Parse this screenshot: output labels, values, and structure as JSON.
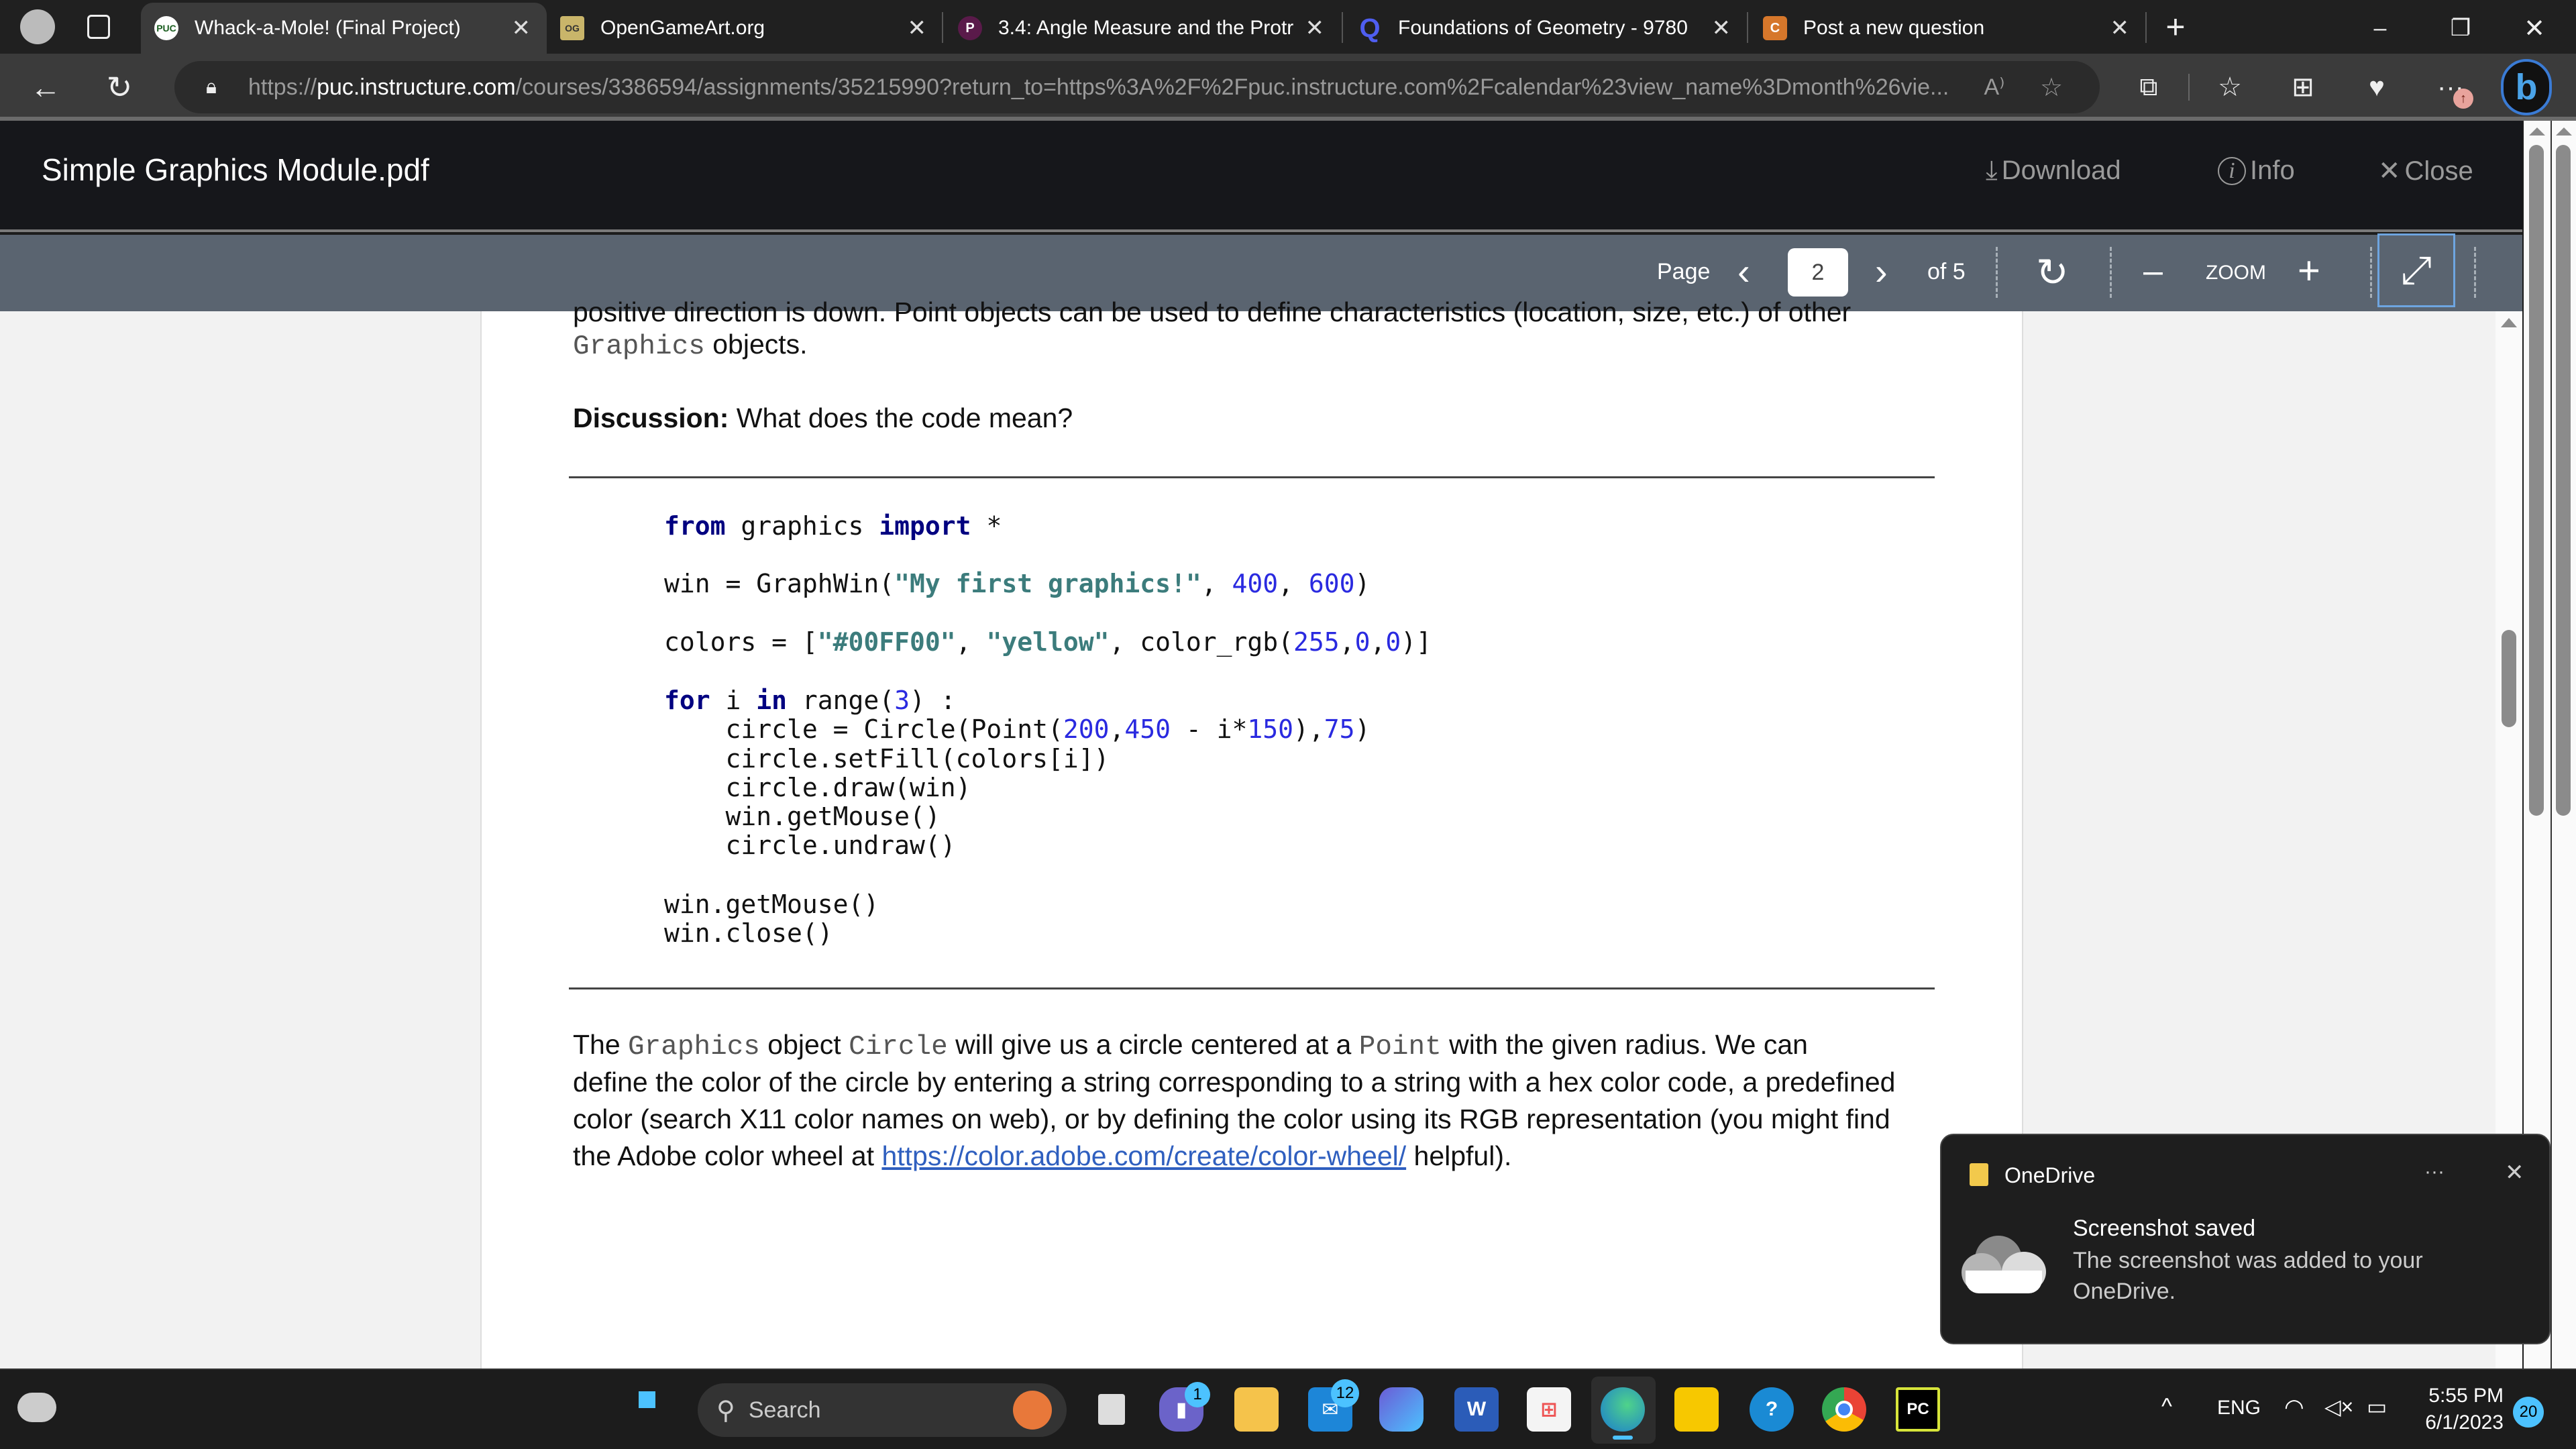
{
  "browser": {
    "tabs": [
      {
        "title": "Whack-a-Mole! (Final Project)",
        "favicon": "PUC",
        "active": true
      },
      {
        "title": "OpenGameArt.org",
        "favicon": "OG",
        "active": false
      },
      {
        "title": "3.4: Angle Measure and the Protr",
        "favicon": "P",
        "active": false
      },
      {
        "title": "Foundations of Geometry - 9780",
        "favicon": "Q",
        "active": false
      },
      {
        "title": "Post a new question",
        "favicon": "C",
        "active": false
      }
    ],
    "new_tab": "+",
    "url_prefix": "https://",
    "url_host": "puc.instructure.com",
    "url_rest": "/courses/3386594/assignments/35215990?return_to=https%3A%2F%2Fpuc.instructure.com%2Fcalendar%23view_name%3Dmonth%26vie...",
    "window_controls": {
      "minimize": "–",
      "restore": "❐",
      "close": "✕"
    }
  },
  "viewer": {
    "file_title": "Simple Graphics Module.pdf",
    "download_label": "Download",
    "info_label": "Info",
    "close_label": "Close",
    "page_label": "Page",
    "current_page": "2",
    "of_label": "of 5",
    "zoom_label": "ZOOM"
  },
  "document": {
    "cut_line": "positive direction is down.  Point  objects can be used to define characteristics (location, size, etc.) of other",
    "graphics_word": "Graphics",
    "objects_word": " objects.",
    "discussion_bold": "Discussion:",
    "discussion_text": " What does the code mean?",
    "code": {
      "l1_kw1": "from",
      "l1_mid": " graphics ",
      "l1_kw2": "import",
      "l1_end": " *",
      "l2_a": "win = GraphWin(",
      "l2_str": "\"My first graphics!\"",
      "l2_b": ", ",
      "l2_n1": "400",
      "l2_c": ", ",
      "l2_n2": "600",
      "l2_d": ")",
      "l3_a": "colors = [",
      "l3_s1": "\"#00FF00\"",
      "l3_b": ", ",
      "l3_s2": "\"yellow\"",
      "l3_c": ", color_rgb(",
      "l3_n1": "255",
      "l3_d": ",",
      "l3_n2": "0",
      "l3_e": ",",
      "l3_n3": "0",
      "l3_f": ")]",
      "l4_kw1": "for",
      "l4_a": " i ",
      "l4_kw2": "in",
      "l4_b": " range(",
      "l4_n": "3",
      "l4_c": ") :",
      "l5_a": "    circle = Circle(Point(",
      "l5_n1": "200",
      "l5_b": ",",
      "l5_n2": "450",
      "l5_c": " - i*",
      "l5_n3": "150",
      "l5_d": "),",
      "l5_n4": "75",
      "l5_e": ")",
      "l6": "    circle.setFill(colors[i])",
      "l7": "    circle.draw(win)",
      "l8": "    win.getMouse()",
      "l9": "    circle.undraw()",
      "l10": "win.getMouse()",
      "l11": "win.close()"
    },
    "para": {
      "p1a": "The ",
      "p1_m1": "Graphics",
      "p1b": " object ",
      "p1_m2": "Circle",
      "p1c": " will give us a circle centered at a ",
      "p1_m3": "Point",
      "p1d": " with the given radius. We can",
      "p2": "define the color of the circle by entering a string corresponding to a string with a hex color code, a predefined",
      "p3": "color (search X11 color names on web), or by defining the color using its RGB representation (you might find",
      "p4a": "the Adobe color wheel at ",
      "p4_link": "https://color.adobe.com/create/color-wheel/",
      "p4b": " helpful)."
    }
  },
  "toast": {
    "app": "OneDrive",
    "more": "···",
    "close": "✕",
    "title": "Screenshot saved",
    "body1": "The screenshot was added to your",
    "body2": "OneDrive."
  },
  "taskbar": {
    "search_label": "Search",
    "teams_badge": "1",
    "mail_badge": "12",
    "pycharm_label": "PC",
    "word_label": "W",
    "lang": "ENG",
    "time": "5:55 PM",
    "date": "6/1/2023",
    "notif_count": "20"
  }
}
